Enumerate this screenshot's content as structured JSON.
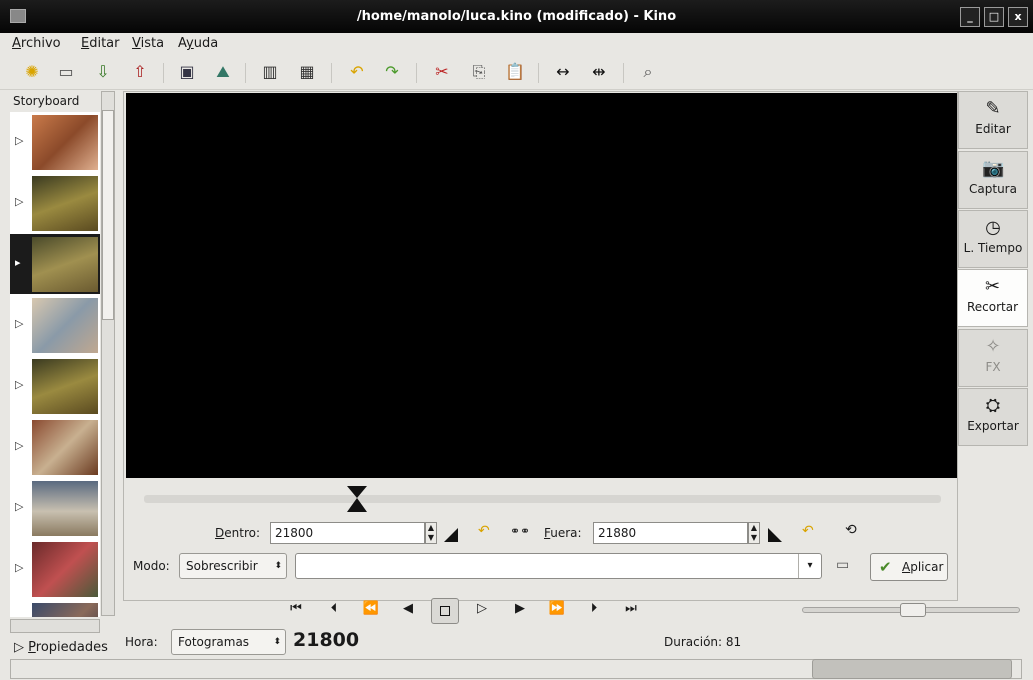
{
  "window": {
    "title": "/home/manolo/luca.kino (modificado) - Kino",
    "min": "_",
    "max": "□",
    "close": "x"
  },
  "menu": [
    {
      "u": "A",
      "rest": "rchivo"
    },
    {
      "u": "E",
      "rest": "ditar"
    },
    {
      "u": "V",
      "rest": "ista"
    },
    {
      "u": "A",
      "rest": "yuda",
      "prefix": "",
      "full": "Ayuda"
    }
  ],
  "storyboard": {
    "title": "Storyboard",
    "arrow": "▷",
    "sel_arrow": "▸"
  },
  "sidetabs": [
    {
      "label": "Editar",
      "icon": "✎"
    },
    {
      "label": "Captura",
      "icon": "📷"
    },
    {
      "label": "L. Tiempo",
      "icon": "◷"
    },
    {
      "label": "Recortar",
      "icon": "✂"
    },
    {
      "label": "FX",
      "icon": "✧"
    },
    {
      "label": "Exportar",
      "icon": "⛭"
    }
  ],
  "trim": {
    "dentro_label_u": "D",
    "dentro_label_rest": "entro:",
    "dentro_value": "21800",
    "fuera_label_u": "F",
    "fuera_label_rest": "uera:",
    "fuera_value": "21880"
  },
  "modo": {
    "label": "Modo:",
    "value": "Sobrescribir",
    "path": ""
  },
  "aplicar": {
    "u": "A",
    "rest": "plicar"
  },
  "propiedades": {
    "arrow": "▷",
    "u": "P",
    "rest": "ropiedades"
  },
  "hora": {
    "label": "Hora:",
    "unit": "Fotogramas",
    "frame": "21800"
  },
  "duracion": "Duración: 81",
  "colors": {
    "titlebar": "#0b0b0b",
    "video": "#000000",
    "accent": "#4a8a2a"
  }
}
